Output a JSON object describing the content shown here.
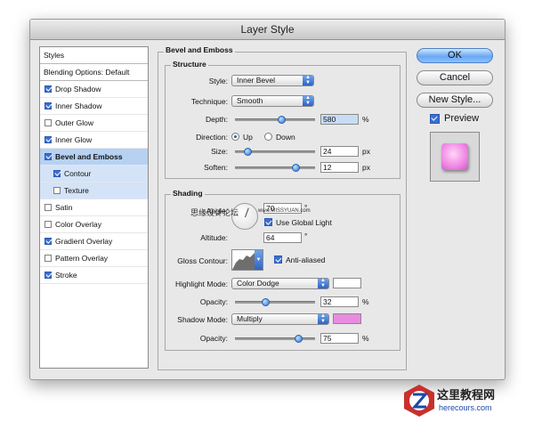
{
  "window": {
    "title": "Layer Style"
  },
  "styles_panel": {
    "header": "Styles",
    "blending": "Blending Options: Default",
    "items": [
      {
        "label": "Drop Shadow",
        "checked": true
      },
      {
        "label": "Inner Shadow",
        "checked": true
      },
      {
        "label": "Outer Glow",
        "checked": false
      },
      {
        "label": "Inner Glow",
        "checked": true
      },
      {
        "label": "Bevel and Emboss",
        "checked": true
      },
      {
        "label": "Contour",
        "checked": true
      },
      {
        "label": "Texture",
        "checked": false
      },
      {
        "label": "Satin",
        "checked": false
      },
      {
        "label": "Color Overlay",
        "checked": false
      },
      {
        "label": "Gradient Overlay",
        "checked": true
      },
      {
        "label": "Pattern Overlay",
        "checked": false
      },
      {
        "label": "Stroke",
        "checked": true
      }
    ]
  },
  "bevel": {
    "title": "Bevel and Emboss",
    "structure_title": "Structure",
    "style_label": "Style:",
    "style_value": "Inner Bevel",
    "technique_label": "Technique:",
    "technique_value": "Smooth",
    "depth_label": "Depth:",
    "depth_value": "580",
    "depth_unit": "%",
    "direction_label": "Direction:",
    "up_label": "Up",
    "down_label": "Down",
    "size_label": "Size:",
    "size_value": "24",
    "size_unit": "px",
    "soften_label": "Soften:",
    "soften_value": "12",
    "soften_unit": "px"
  },
  "shading": {
    "title": "Shading",
    "angle_label": "Angle:",
    "angle_value": "70",
    "degree": "°",
    "global_light_label": "Use Global Light",
    "altitude_label": "Altitude:",
    "altitude_value": "64",
    "gloss_label": "Gloss Contour:",
    "anti_aliased_label": "Anti-aliased",
    "highlight_label": "Highlight Mode:",
    "highlight_value": "Color Dodge",
    "highlight_opacity_label": "Opacity:",
    "highlight_opacity_value": "32",
    "pct": "%",
    "shadow_label": "Shadow Mode:",
    "shadow_value": "Multiply",
    "shadow_opacity_label": "Opacity:",
    "shadow_opacity_value": "75"
  },
  "buttons": {
    "ok": "OK",
    "cancel": "Cancel",
    "new_style": "New Style...",
    "preview": "Preview"
  },
  "colors": {
    "highlight": "#ffffff",
    "shadow": "#e88ce0",
    "accent": "#3a6fd1"
  },
  "watermark": {
    "cn": "思缘设计论坛",
    "url": "www.MISSYUAN.com"
  },
  "brand": {
    "name": "这里教程网",
    "url": "herecours.com"
  }
}
